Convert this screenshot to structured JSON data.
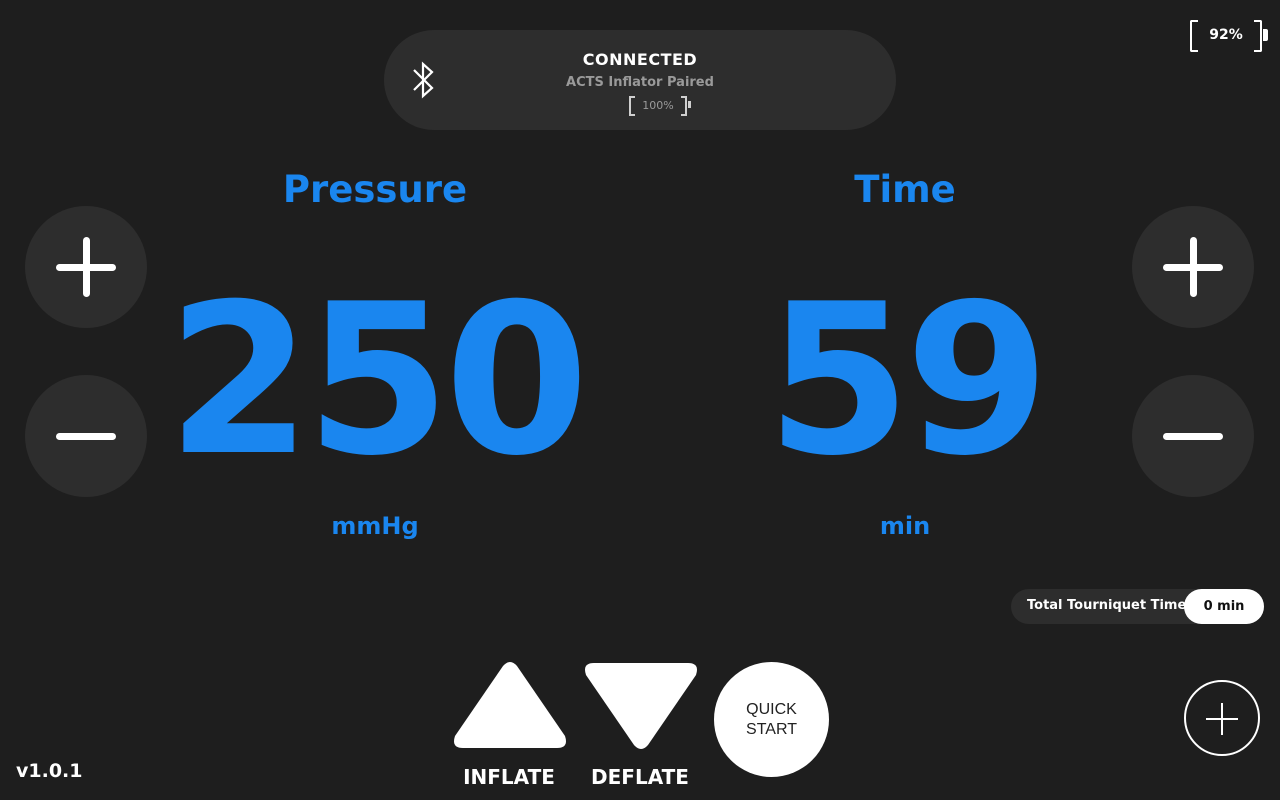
{
  "device_battery": {
    "percent_label": "92%"
  },
  "connection": {
    "status": "CONNECTED",
    "device_name": "ACTS Inflator Paired",
    "inflator_battery_label": "100%",
    "icon": "bluetooth-icon"
  },
  "pressure": {
    "label": "Pressure",
    "value": "250",
    "unit": "mmHg"
  },
  "time": {
    "label": "Time",
    "value": "59",
    "unit": "min"
  },
  "total_tourniquet_time": {
    "label": "Total Tourniquet Time",
    "value": "0 min"
  },
  "controls": {
    "inflate_label": "INFLATE",
    "deflate_label": "DEFLATE",
    "quick_start_line1": "QUICK",
    "quick_start_line2": "START"
  },
  "icons": {
    "increase": "plus-icon",
    "decrease": "minus-icon",
    "inflate": "triangle-up-icon",
    "deflate": "triangle-down-icon",
    "add": "plus-circle-icon"
  },
  "colors": {
    "accent": "#1a86ef",
    "background": "#1e1e1e",
    "surface": "#2d2d2d"
  },
  "version": "v1.0.1"
}
